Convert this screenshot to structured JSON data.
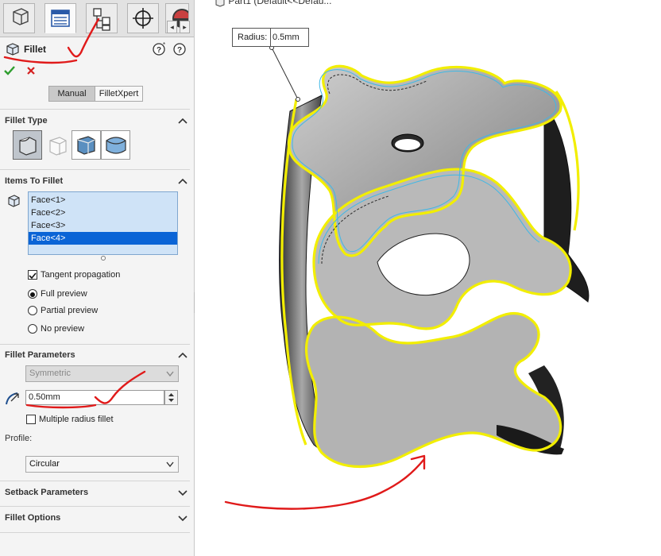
{
  "panel": {
    "title": "Fillet",
    "tab_names": [
      "features-tab",
      "property-manager-tab",
      "configuration-manager-tab",
      "dimxpert-tab",
      "display-manager-tab"
    ],
    "mode_tabs": [
      {
        "label": "Manual",
        "active": true
      },
      {
        "label": "FilletXpert",
        "active": false
      }
    ]
  },
  "fillet_type": {
    "title": "Fillet Type"
  },
  "items": {
    "title": "Items To Fillet",
    "faces": [
      "Face<1>",
      "Face<2>",
      "Face<3>",
      "Face<4>"
    ],
    "selected_index": 3,
    "tangent_propagation": {
      "label": "Tangent propagation",
      "checked": true
    },
    "preview": [
      {
        "label": "Full preview",
        "selected": true
      },
      {
        "label": "Partial preview",
        "selected": false
      },
      {
        "label": "No preview",
        "selected": false
      }
    ]
  },
  "params": {
    "title": "Fillet Parameters",
    "method": "Symmetric",
    "radius_value": "0.50mm",
    "multiple_radius": {
      "label": "Multiple radius fillet",
      "checked": false
    },
    "profile_label": "Profile:",
    "profile_value": "Circular"
  },
  "collapsed_sections": [
    {
      "title": "Setback Parameters"
    },
    {
      "title": "Fillet Options"
    }
  ],
  "viewport": {
    "tree_label": "Part1  (Default<<Defau...",
    "callout_label": "Radius:",
    "callout_value": "0.5mm"
  },
  "colors": {
    "selection_blue": "#0a64d6",
    "preview_yellow": "#f2ee00",
    "annotation_red": "#e01a1a",
    "accept_green": "#2e9e2e"
  }
}
